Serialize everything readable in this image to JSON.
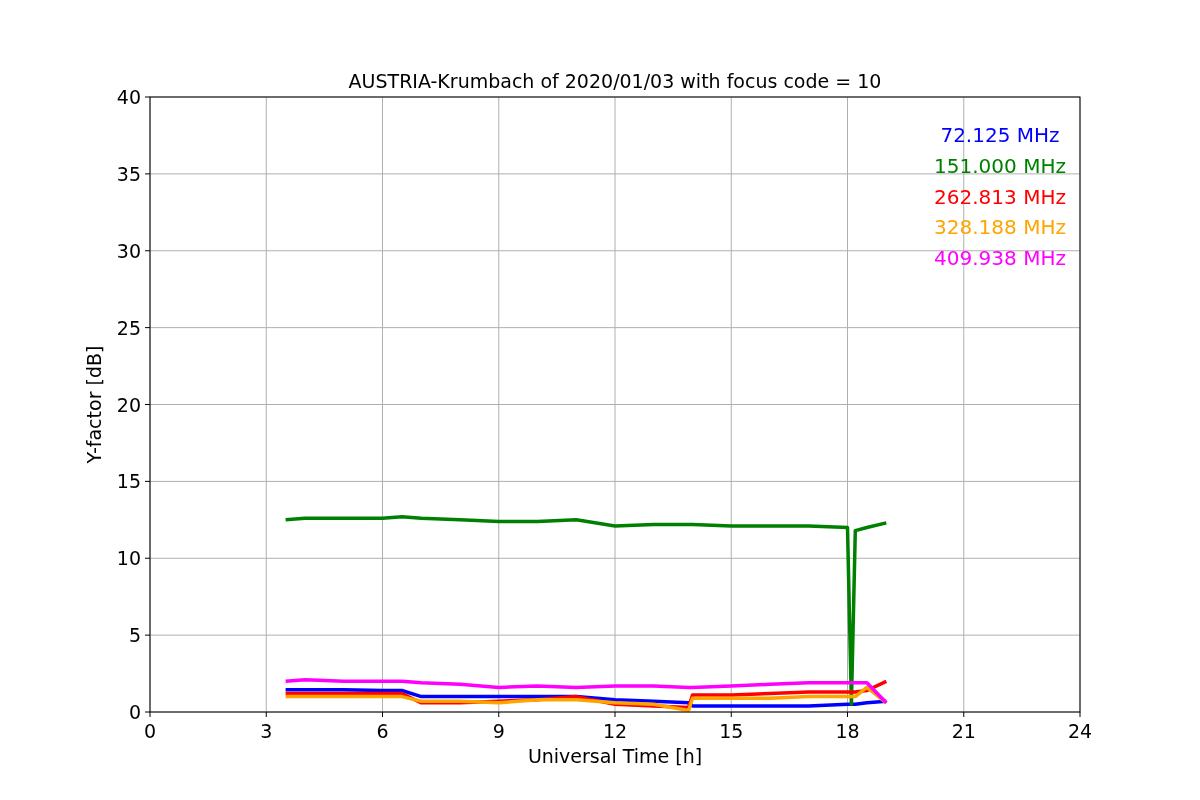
{
  "chart_data": {
    "type": "line",
    "title": "AUSTRIA-Krumbach of 2020/01/03 with focus code = 10",
    "xlabel": "Universal Time [h]",
    "ylabel": "Y-factor [dB]",
    "x": [
      3.5,
      4,
      5,
      6,
      6.5,
      7,
      8,
      9,
      10,
      11,
      12,
      13,
      13.9,
      14,
      15,
      16,
      17,
      18,
      18.1,
      18.2,
      18.5,
      19
    ],
    "series": [
      {
        "name": "72.125 MHz",
        "color": "#0000ff",
        "values": [
          1.45,
          1.45,
          1.45,
          1.4,
          1.4,
          1.0,
          1.0,
          1.0,
          1.0,
          1.0,
          0.8,
          0.7,
          0.6,
          0.4,
          0.4,
          0.4,
          0.4,
          0.5,
          0.5,
          0.5,
          0.6,
          0.7
        ]
      },
      {
        "name": "151.000 MHz",
        "color": "#008000",
        "values": [
          12.5,
          12.6,
          12.6,
          12.6,
          12.7,
          12.6,
          12.5,
          12.4,
          12.4,
          12.5,
          12.1,
          12.2,
          12.2,
          12.2,
          12.1,
          12.1,
          12.1,
          12.0,
          0.5,
          11.8,
          12.0,
          12.3
        ]
      },
      {
        "name": "262.813 MHz",
        "color": "#ff0000",
        "values": [
          1.2,
          1.2,
          1.2,
          1.2,
          1.2,
          0.6,
          0.6,
          0.7,
          0.8,
          1.0,
          0.5,
          0.4,
          0.3,
          1.1,
          1.1,
          1.2,
          1.3,
          1.3,
          1.3,
          1.3,
          1.4,
          2.0
        ]
      },
      {
        "name": "328.188 MHz",
        "color": "#ffa500",
        "values": [
          1.0,
          1.0,
          1.0,
          1.0,
          1.0,
          0.7,
          0.7,
          0.6,
          0.8,
          0.8,
          0.6,
          0.5,
          0.1,
          0.9,
          0.9,
          0.9,
          1.0,
          1.0,
          1.0,
          1.0,
          1.6,
          0.6
        ]
      },
      {
        "name": "409.938 MHz",
        "color": "#ff00ff",
        "values": [
          2.0,
          2.1,
          2.0,
          2.0,
          2.0,
          1.9,
          1.8,
          1.6,
          1.7,
          1.6,
          1.7,
          1.7,
          1.6,
          1.6,
          1.7,
          1.8,
          1.9,
          1.9,
          1.9,
          1.9,
          1.9,
          0.6
        ]
      }
    ],
    "grid": true,
    "xlim": [
      0,
      24
    ],
    "ylim": [
      0,
      40
    ],
    "xticks": [
      0,
      3,
      6,
      9,
      12,
      15,
      18,
      21,
      24
    ],
    "yticks": [
      0,
      5,
      10,
      15,
      20,
      25,
      30,
      35,
      40
    ]
  }
}
